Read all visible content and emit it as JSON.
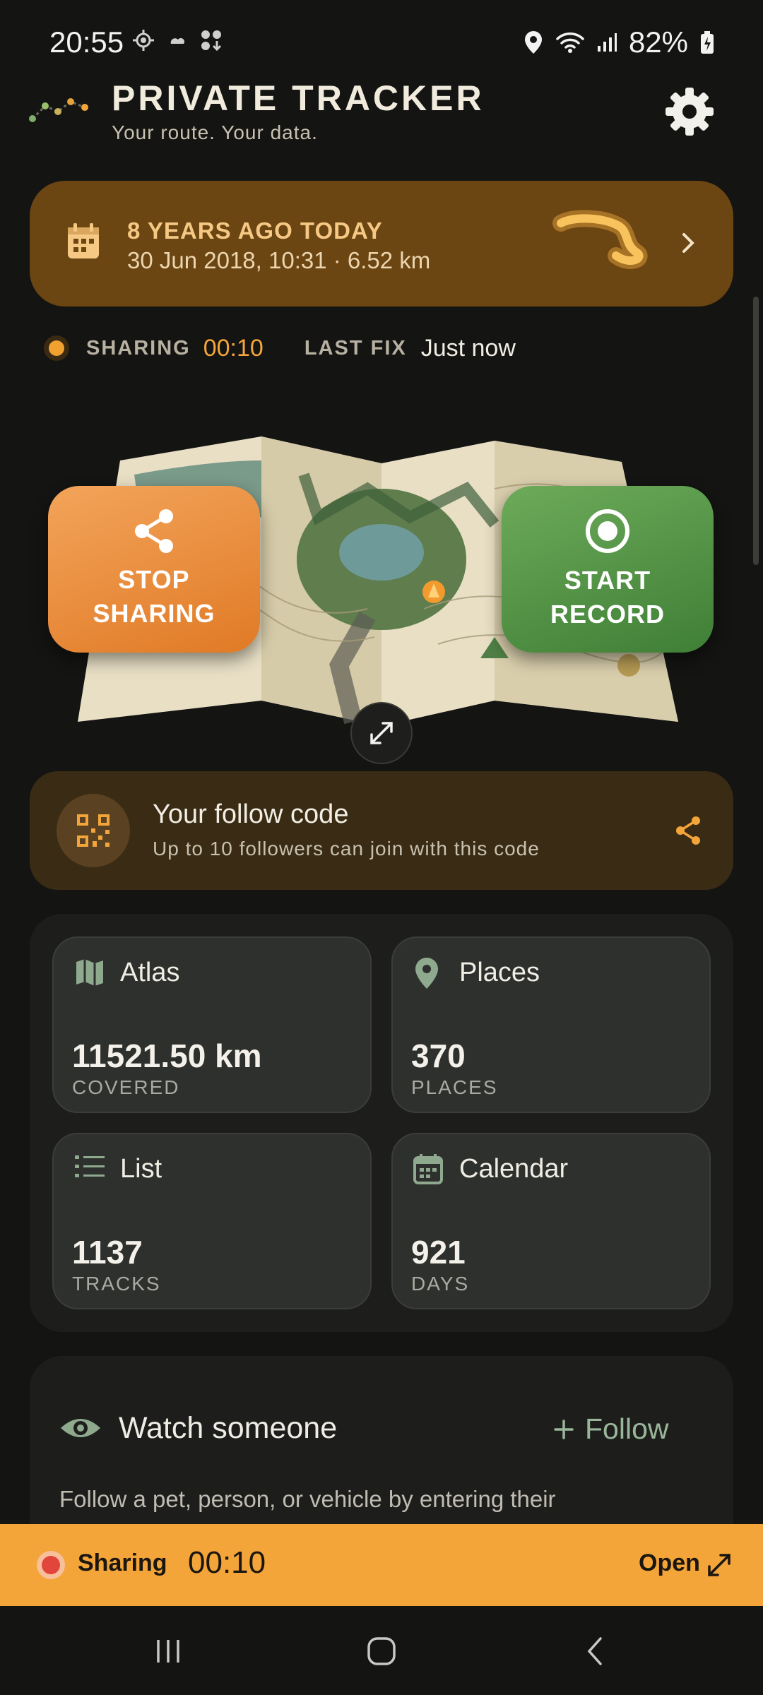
{
  "status_bar": {
    "time": "20:55",
    "battery": "82%"
  },
  "header": {
    "title": "PRIVATE TRACKER",
    "subtitle": "Your route. Your data."
  },
  "memory": {
    "title": "8 YEARS AGO TODAY",
    "detail": "30 Jun 2018, 10:31 · 6.52 km"
  },
  "status": {
    "sharing_label": "SHARING",
    "sharing_time": "00:10",
    "fix_label": "LAST FIX",
    "fix_value": "Just now"
  },
  "actions": {
    "stop_line1": "STOP",
    "stop_line2": "SHARING",
    "start_line1": "START",
    "start_line2": "RECORD"
  },
  "follow_code": {
    "title": "Your follow code",
    "subtitle": "Up to 10 followers can join with this code"
  },
  "stats": [
    {
      "title": "Atlas",
      "value": "11521.50 km",
      "unit": "COVERED"
    },
    {
      "title": "Places",
      "value": "370",
      "unit": "PLACES"
    },
    {
      "title": "List",
      "value": "1137",
      "unit": "TRACKS"
    },
    {
      "title": "Calendar",
      "value": "921",
      "unit": "DAYS"
    }
  ],
  "watch": {
    "title": "Watch someone",
    "follow_label": "Follow",
    "description": "Follow a pet, person, or vehicle by entering their"
  },
  "sharing_bar": {
    "label": "Sharing",
    "time": "00:10",
    "open_label": "Open"
  },
  "colors": {
    "accent_orange": "#f3a53a",
    "stop_button": "#e8873a",
    "start_button": "#4f8f44",
    "memory_card": "#6b4512",
    "follow_card": "#3a2c14"
  }
}
